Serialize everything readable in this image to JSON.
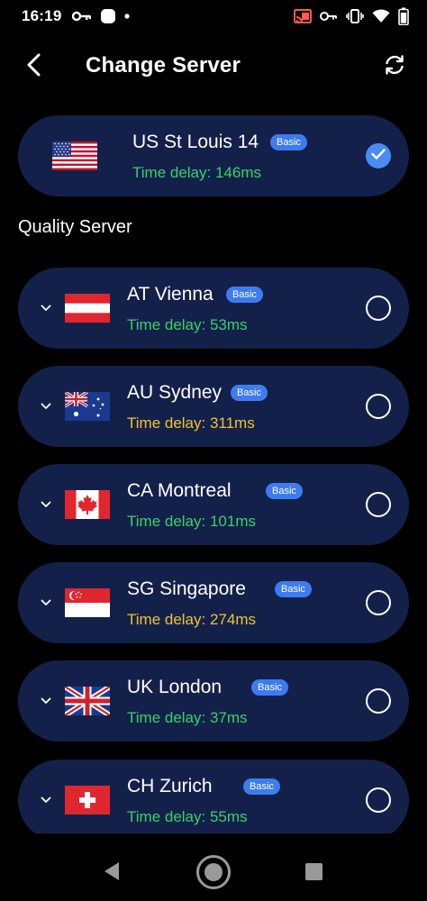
{
  "status_bar": {
    "time": "16:19"
  },
  "header": {
    "title": "Change Server"
  },
  "selected_server": {
    "name": "US St Louis 14",
    "badge": "Basic",
    "delay": "Time delay: 146ms",
    "flag": "us-flag",
    "selected": true
  },
  "section_title": "Quality Server",
  "servers": [
    {
      "name": "AT Vienna",
      "badge": "Basic",
      "delay": "Time delay: 53ms",
      "delay_color": "#3ccf6a",
      "flag": "austria-flag"
    },
    {
      "name": "AU Sydney",
      "badge": "Basic",
      "delay": "Time delay: 311ms",
      "delay_color": "#f1c232",
      "flag": "australia-flag"
    },
    {
      "name": "CA Montreal",
      "badge": "Basic",
      "delay": "Time delay: 101ms",
      "delay_color": "#3ccf6a",
      "flag": "canada-flag"
    },
    {
      "name": "SG Singapore",
      "badge": "Basic",
      "delay": "Time delay: 274ms",
      "delay_color": "#f1c232",
      "flag": "singapore-flag"
    },
    {
      "name": "UK London",
      "badge": "Basic",
      "delay": "Time delay: 37ms",
      "delay_color": "#3ccf6a",
      "flag": "uk-flag"
    },
    {
      "name": "CH Zurich",
      "badge": "Basic",
      "delay": "Time delay: 55ms",
      "delay_color": "#3ccf6a",
      "flag": "switzerland-flag"
    }
  ],
  "colors": {
    "background": "#000000",
    "card": "#13214a",
    "badge": "#3d7cf0",
    "good_delay": "#3ccf6a",
    "medium_delay": "#f1c232",
    "selected_check": "#4a8cf5"
  },
  "icons": {
    "status": [
      "key-icon",
      "app-square-icon",
      "dot-icon",
      "cast-icon",
      "vpn-key-icon",
      "vibrate-icon",
      "wifi-icon",
      "battery-icon"
    ],
    "header": [
      "back-arrow-icon",
      "refresh-icon"
    ],
    "nav": [
      "nav-back-icon",
      "nav-home-icon",
      "nav-recents-icon"
    ]
  }
}
